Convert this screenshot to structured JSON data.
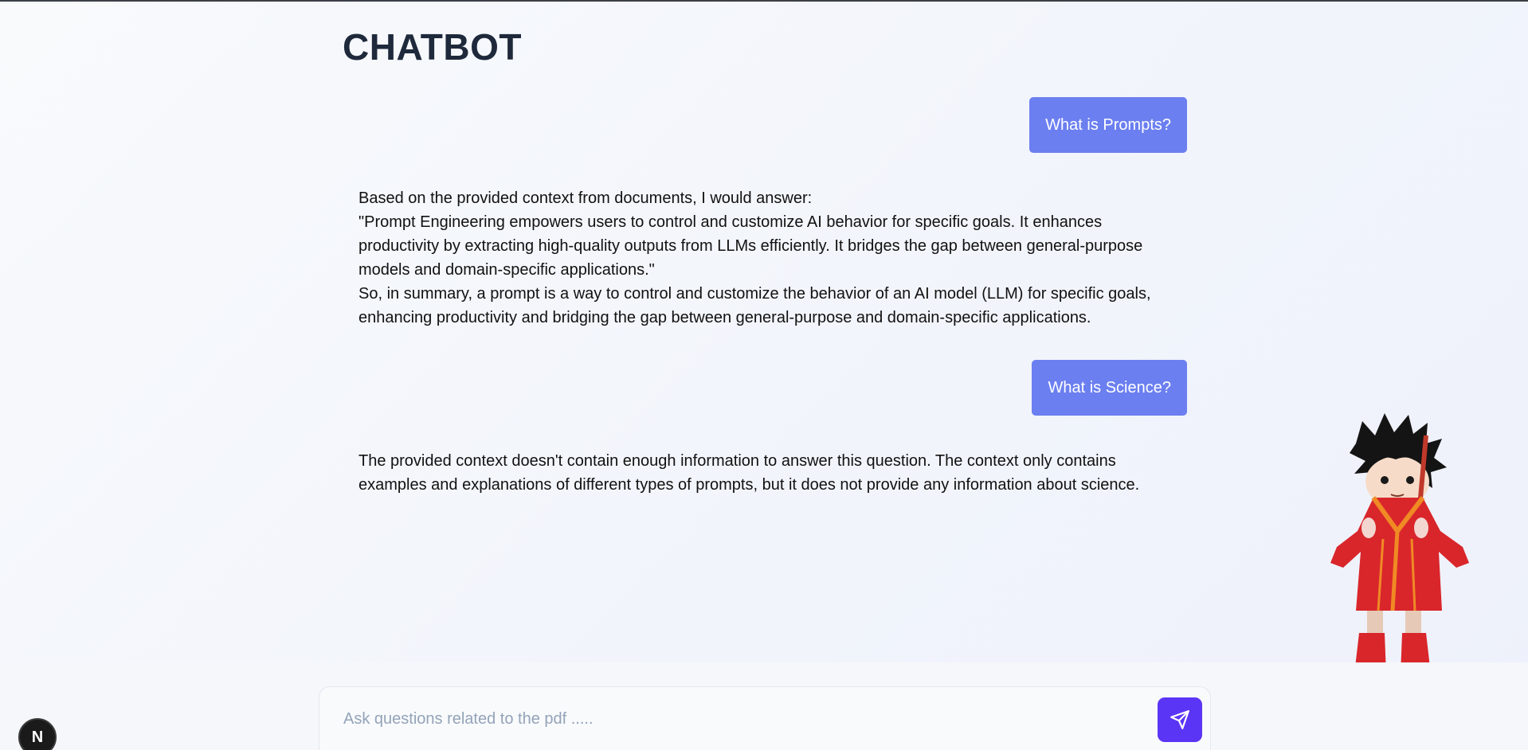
{
  "header": {
    "title": "CHATBOT"
  },
  "messages": [
    {
      "role": "user",
      "text": "What is Prompts?"
    },
    {
      "role": "bot",
      "lines": [
        "Based on the provided context from documents, I would answer:",
        "\"Prompt Engineering empowers users to control and customize AI behavior for specific goals. It enhances productivity by extracting high-quality outputs from LLMs efficiently. It bridges the gap between general-purpose models and domain-specific applications.\"",
        "So, in summary, a prompt is a way to control and customize the behavior of an AI model (LLM) for specific goals, enhancing productivity and bridging the gap between general-purpose and domain-specific applications."
      ]
    },
    {
      "role": "user",
      "text": "What is Science?"
    },
    {
      "role": "bot",
      "lines": [
        "The provided context doesn't contain enough information to answer this question. The context only contains examples and explanations of different types of prompts, but it does not provide any information about science."
      ]
    }
  ],
  "composer": {
    "placeholder": "Ask questions related to the pdf .....",
    "value": "",
    "send_icon": "paper-plane-icon"
  },
  "dev_badge": {
    "letter": "N"
  },
  "mascot": {
    "icon": "anime-character-mascot"
  },
  "colors": {
    "user_bubble": "#6b7ff0",
    "send_button": "#5b35f5",
    "title": "#1e293b"
  }
}
